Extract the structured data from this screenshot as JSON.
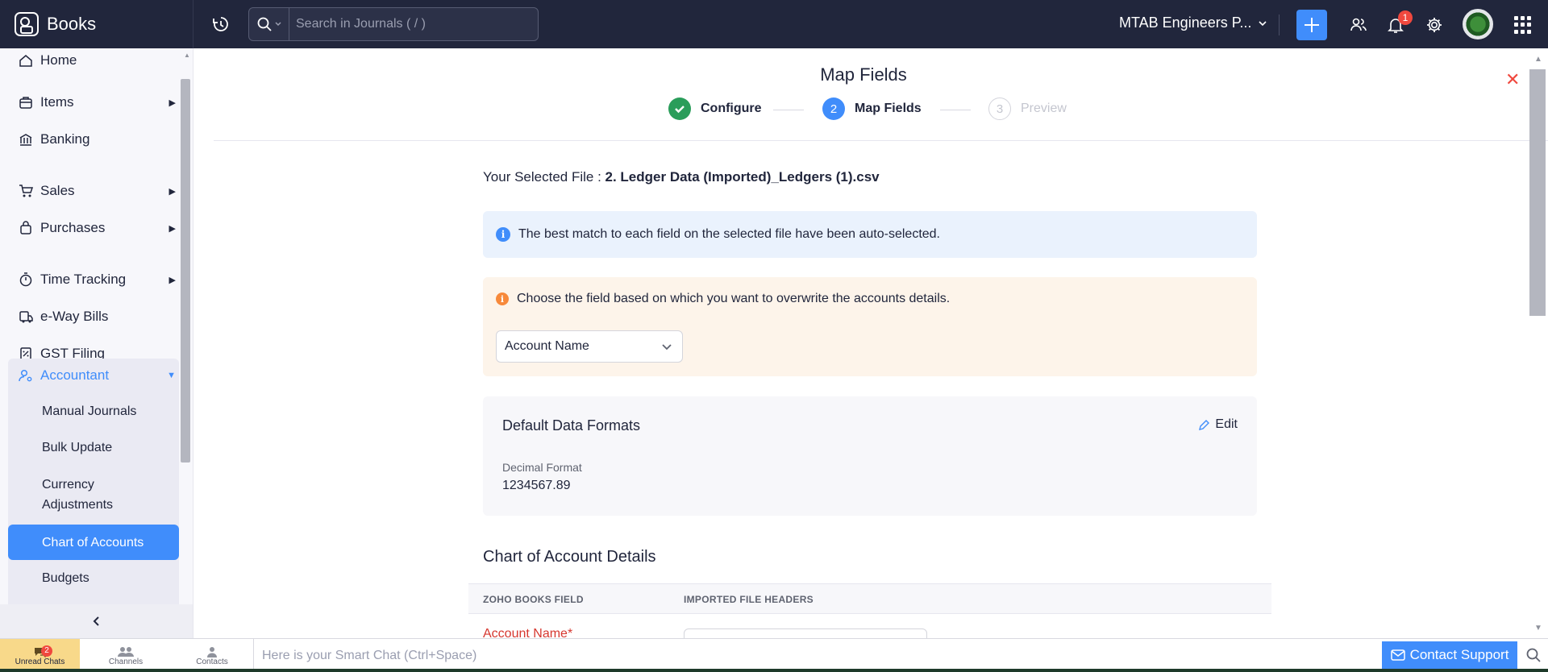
{
  "app": {
    "name": "Books"
  },
  "search": {
    "placeholder": "Search in Journals ( / )"
  },
  "org": {
    "name": "MTAB Engineers P..."
  },
  "notifications": {
    "count": "1"
  },
  "sidebar": {
    "items": [
      {
        "label": "Home",
        "icon": "home-icon"
      },
      {
        "label": "Items",
        "icon": "items-icon"
      },
      {
        "label": "Banking",
        "icon": "bank-icon"
      },
      {
        "label": "Sales",
        "icon": "cart-icon"
      },
      {
        "label": "Purchases",
        "icon": "bag-icon"
      },
      {
        "label": "Time Tracking",
        "icon": "stopwatch-icon"
      },
      {
        "label": "e-Way Bills",
        "icon": "eway-bill-icon"
      },
      {
        "label": "GST Filing",
        "icon": "gst-icon"
      },
      {
        "label": "Accountant",
        "icon": "user-gear-icon"
      }
    ],
    "sub_items": [
      {
        "label": "Manual Journals"
      },
      {
        "label": "Bulk Update"
      },
      {
        "label": "Currency Adjustments"
      },
      {
        "label": "Chart of Accounts"
      },
      {
        "label": "Budgets"
      }
    ],
    "active_sub": "Chart of Accounts"
  },
  "page": {
    "title": "Map Fields",
    "steps": [
      {
        "num": "1",
        "label": "Configure",
        "state": "done"
      },
      {
        "num": "2",
        "label": "Map Fields",
        "state": "current"
      },
      {
        "num": "3",
        "label": "Preview",
        "state": "upcoming"
      }
    ],
    "selected_file_prefix": "Your Selected File : ",
    "selected_file_name": "2. Ledger Data (Imported)_Ledgers (1).csv",
    "info_message": "The best match to each field on the selected file have been auto-selected.",
    "warn_message": "Choose the field based on which you want to overwrite the accounts details.",
    "overwrite_field": "Account Name",
    "formats": {
      "title": "Default Data Formats",
      "edit_label": "Edit",
      "decimal_label": "Decimal Format",
      "decimal_value": "1234567.89"
    },
    "coa_title": "Chart of Account Details",
    "table": {
      "col1": "ZOHO BOOKS FIELD",
      "col2": "IMPORTED FILE HEADERS",
      "first_row_label": "Account Name*"
    }
  },
  "bottombar": {
    "unread_chats_label": "Unread Chats",
    "unread_count": "2",
    "channels_label": "Channels",
    "contacts_label": "Contacts",
    "smart_chat_placeholder": "Here is your Smart Chat (Ctrl+Space)",
    "contact_support_label": "Contact Support"
  },
  "colors": {
    "topbar": "#21263c",
    "accent": "#408dfb",
    "success": "#2a9d5a",
    "danger": "#f0483e",
    "warning": "#f7893b"
  }
}
